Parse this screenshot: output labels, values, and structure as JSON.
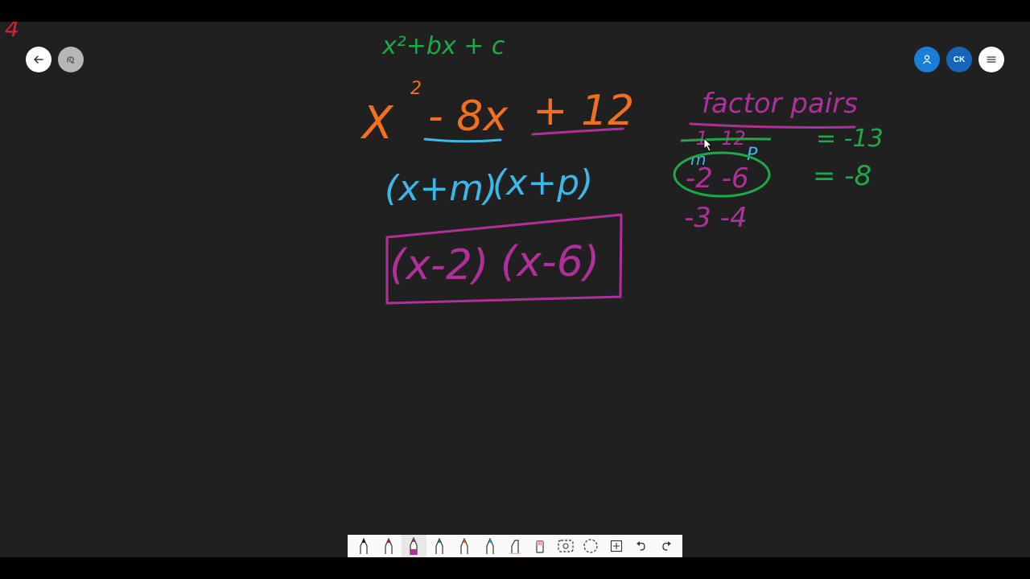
{
  "board": {
    "page_number": "4",
    "general_form": "x²+bx + c",
    "expression": {
      "x": "X",
      "exponent": "2",
      "b_term": "- 8x",
      "c_term": "+ 12"
    },
    "factored_template": {
      "left": "(x+m)",
      "right": "(x+p)"
    },
    "answer": {
      "left": "(x-2)",
      "right": "(x-6)"
    },
    "factor_pairs": {
      "title": "factor pairs",
      "pairs": [
        {
          "text": "-1 -12",
          "sum": "= -13"
        },
        {
          "text": "-2 -6",
          "sum": "= -8"
        },
        {
          "text": "-3 -4",
          "sum": ""
        }
      ],
      "m_label": "m",
      "p_label": "P"
    }
  },
  "controls": {
    "user_initials": "CK"
  },
  "colors": {
    "orange": "#f07020",
    "green": "#1fa84a",
    "blue": "#3bb8e8",
    "magenta": "#b0309a",
    "red": "#d42030"
  },
  "toolbar": {
    "tools": [
      "pen-black-icon",
      "pen-red-icon",
      "pen-magenta-icon",
      "pen-teal-icon",
      "pen-orange-icon",
      "pen-blue-icon",
      "highlighter-icon",
      "eraser-icon",
      "lasso-select-icon",
      "circle-select-icon",
      "add-space-icon",
      "undo-icon",
      "redo-icon"
    ]
  }
}
